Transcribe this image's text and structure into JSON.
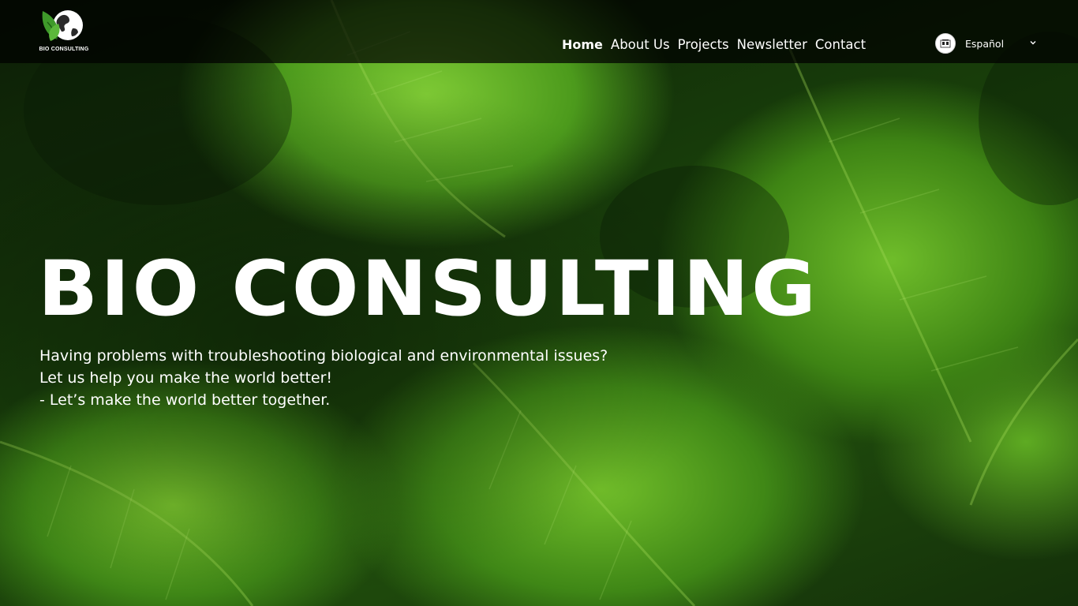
{
  "brand": {
    "logo_text": "BIO CONSULTING",
    "logo_icon": "leaf-globe-icon",
    "accent_color": "#4fa52b"
  },
  "nav": {
    "items": [
      {
        "label": "Home",
        "active": true
      },
      {
        "label": "About Us",
        "active": false
      },
      {
        "label": "Projects",
        "active": false
      },
      {
        "label": "Newsletter",
        "active": false
      },
      {
        "label": "Contact",
        "active": false
      }
    ]
  },
  "language": {
    "selected": "Español",
    "flag_icon": "spain-flag-icon",
    "dropdown_icon": "chevron-down-icon"
  },
  "hero": {
    "title": "BIO CONSULTING",
    "lines": [
      "Having problems with troubleshooting biological and environmental issues?",
      "Let us help you make the world better!",
      "- Let’s make the world better together."
    ]
  }
}
